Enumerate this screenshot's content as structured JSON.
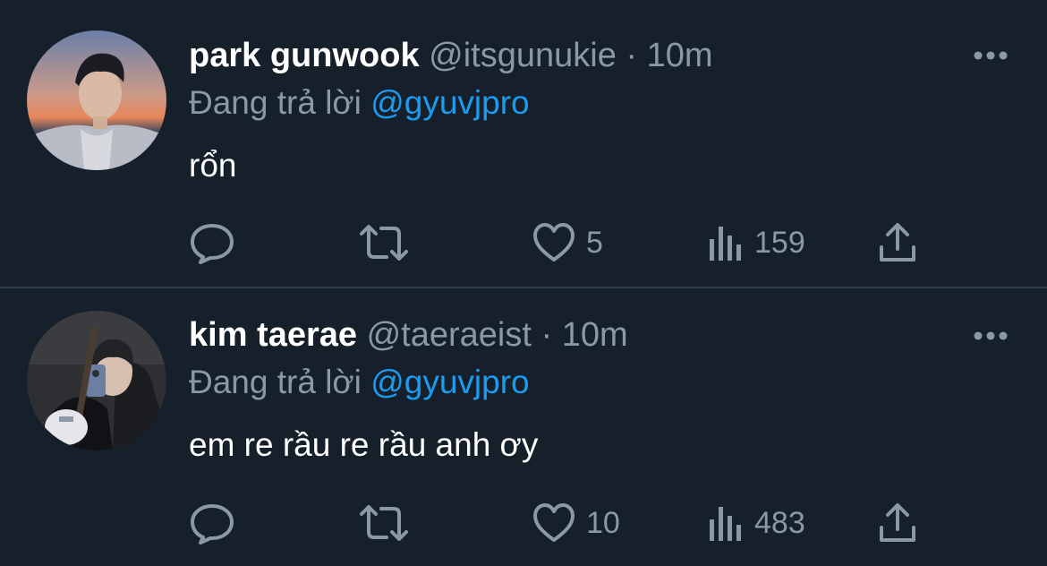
{
  "colors": {
    "background": "#15202b",
    "text": "#ffffff",
    "muted": "#8b98a5",
    "accent": "#1d9bf0",
    "divider": "#2f3b47"
  },
  "tweets": [
    {
      "display_name": "park gunwook",
      "handle": "@itsgunukie",
      "separator": "·",
      "time": "10m",
      "reply_prefix": "Đang trả lời",
      "reply_to": "@gyuvjpro",
      "text": "rổn",
      "likes": "5",
      "views": "159",
      "icons": [
        "reply-icon",
        "retweet-icon",
        "like-icon",
        "views-icon",
        "share-icon",
        "more-icon"
      ]
    },
    {
      "display_name": "kim taerae",
      "handle": "@taeraeist",
      "separator": "·",
      "time": "10m",
      "reply_prefix": "Đang trả lời",
      "reply_to": "@gyuvjpro",
      "text": "em re rầu re rầu anh ơy",
      "likes": "10",
      "views": "483",
      "icons": [
        "reply-icon",
        "retweet-icon",
        "like-icon",
        "views-icon",
        "share-icon",
        "more-icon"
      ]
    }
  ]
}
